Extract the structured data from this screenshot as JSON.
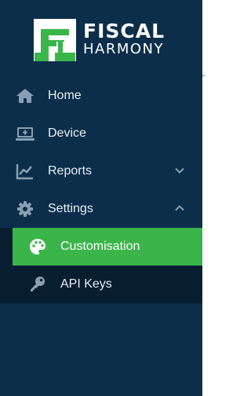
{
  "brand": {
    "name_top": "FISCAL",
    "name_bottom": "HARMONY",
    "logo_color": "#3ab54a"
  },
  "colors": {
    "sidebar_bg": "#0b2e4a",
    "submenu_bg": "#061e30",
    "active_bg": "#3ab54a",
    "icon_color": "#8aa0b2"
  },
  "nav": {
    "items": [
      {
        "label": "Home",
        "icon": "home-icon"
      },
      {
        "label": "Device",
        "icon": "monitor-plus-icon"
      },
      {
        "label": "Reports",
        "icon": "line-chart-icon",
        "expand": "chevron-down-icon"
      },
      {
        "label": "Settings",
        "icon": "gear-icon",
        "expand": "chevron-up-icon"
      }
    ],
    "submenu": [
      {
        "label": "Customisation",
        "icon": "palette-icon",
        "active": true
      },
      {
        "label": "API Keys",
        "icon": "key-icon",
        "active": false
      }
    ]
  }
}
